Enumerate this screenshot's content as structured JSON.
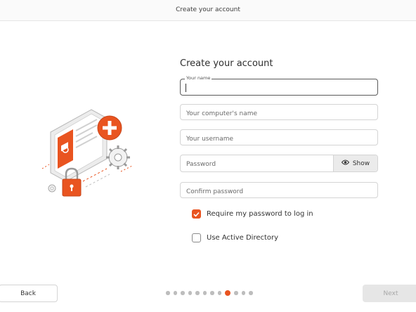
{
  "window": {
    "title": "Create your account"
  },
  "form": {
    "title": "Create your account",
    "name": {
      "label": "Your name",
      "value": "",
      "placeholder": ""
    },
    "computer_name": {
      "placeholder": "Your computer's name",
      "value": ""
    },
    "username": {
      "placeholder": "Your username",
      "value": ""
    },
    "password": {
      "placeholder": "Password",
      "value": "",
      "show_label": "Show",
      "show_icon": "eye-icon"
    },
    "confirm_password": {
      "placeholder": "Confirm password",
      "value": ""
    },
    "require_password": {
      "label": "Require my password to log in",
      "checked": true
    },
    "active_directory": {
      "label": "Use Active Directory",
      "checked": false
    }
  },
  "navigation": {
    "back_label": "Back",
    "next_label": "Next",
    "next_enabled": false,
    "steps_total": 12,
    "current_step": 9
  },
  "colors": {
    "accent": "#E95420",
    "disabled_button": "#E6E6E6"
  },
  "illustration": {
    "name": "account-creation-illustration"
  }
}
